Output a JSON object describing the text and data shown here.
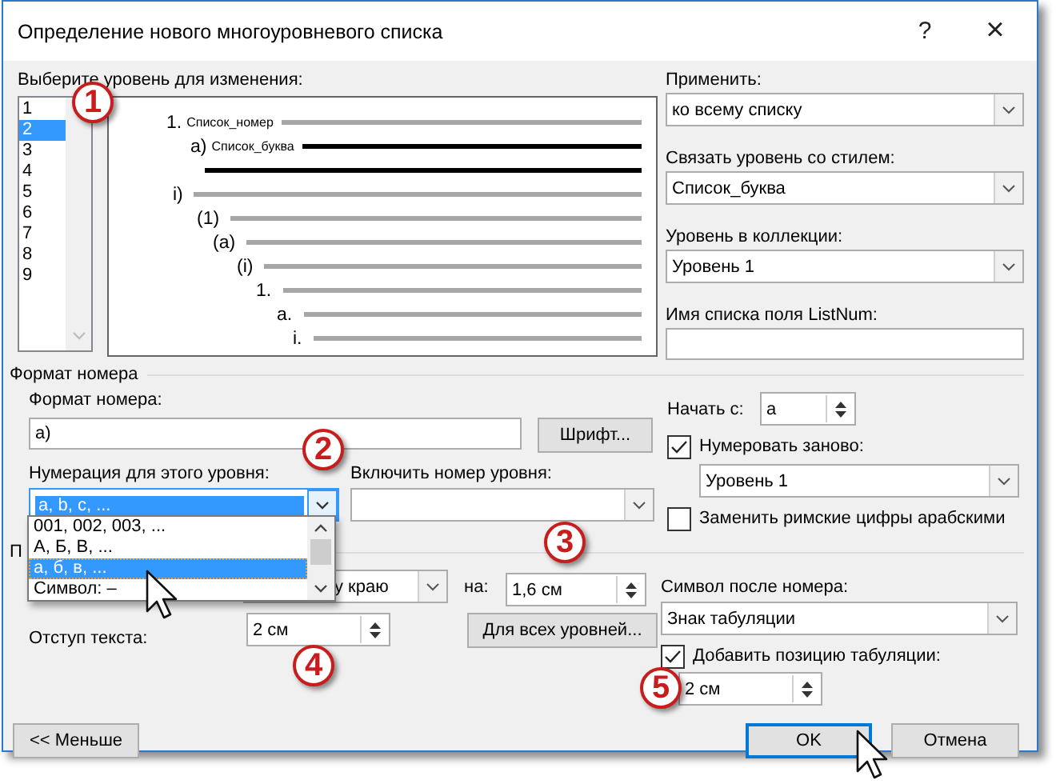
{
  "window": {
    "title": "Определение нового многоуровневого списка",
    "help": "?",
    "close": "×"
  },
  "level_picker": {
    "label": "Выберите уровень для изменения:",
    "levels": [
      {
        "label": "1",
        "selected": false
      },
      {
        "label": "2",
        "selected": true
      },
      {
        "label": "3",
        "selected": false
      },
      {
        "label": "4",
        "selected": false
      },
      {
        "label": "5",
        "selected": false
      },
      {
        "label": "6",
        "selected": false
      },
      {
        "label": "7",
        "selected": false
      },
      {
        "label": "8",
        "selected": false
      },
      {
        "label": "9",
        "selected": false
      }
    ]
  },
  "preview": {
    "items": [
      {
        "number": "1.",
        "style": "Список_номер",
        "selected": false
      },
      {
        "number": "a)",
        "style": "Список_буква",
        "selected": true
      },
      {
        "number": "i)",
        "selected": false
      },
      {
        "number": "(1)",
        "selected": false
      },
      {
        "number": "(a)",
        "selected": false
      },
      {
        "number": "(i)",
        "selected": false
      },
      {
        "number": "1.",
        "selected": false
      },
      {
        "number": "a.",
        "selected": false
      },
      {
        "number": "i.",
        "selected": false
      }
    ]
  },
  "apply": {
    "label": "Применить:",
    "value": "ко всему списку"
  },
  "link_style": {
    "label": "Связать уровень со стилем:",
    "value": "Список_буква"
  },
  "gallery_level": {
    "label": "Уровень в коллекции:",
    "value": "Уровень 1"
  },
  "listnum_name": {
    "label": "Имя списка поля ListNum:"
  },
  "number_format": {
    "title": "Формат номера",
    "format": {
      "label": "Формат номера:",
      "value": "a)"
    },
    "font_button": "Шрифт...",
    "numbering_style": {
      "label": "Нумерация для этого уровня:",
      "value": "a, b, c, ...",
      "expanded": true,
      "options": [
        {
          "label": "001, 002, 003, ...",
          "selected": false
        },
        {
          "label": "А, Б, В, ...",
          "selected": false
        },
        {
          "label": "а, б, в, ...",
          "selected": true
        },
        {
          "label": "Символ:  –",
          "selected": false
        }
      ]
    },
    "include_level": {
      "label": "Включить номер уровня:"
    },
    "start_at": {
      "label": "Начать с:",
      "value": "a"
    },
    "restart": {
      "label": "Нумеровать заново:",
      "checked": true,
      "value": "Уровень 1"
    },
    "legal": {
      "label": "Заменить римские цифры арабскими",
      "checked": false
    }
  },
  "position": {
    "title": "П",
    "alignment": {
      "value": "у краю"
    },
    "aligned_at": {
      "label": "на:",
      "value": "1,6 см"
    },
    "indent": {
      "label": "Отступ текста:",
      "value": "2 см"
    },
    "all_levels_button": "Для всех уровней...",
    "follow": {
      "label": "Символ после номера:",
      "value": "Знак табуляции"
    },
    "tab_stop": {
      "label": "Добавить позицию табуляции:",
      "checked": true,
      "value": "2 см"
    }
  },
  "buttons": [
    {
      "label": "<< Меньше",
      "kind": "more"
    },
    {
      "label": "OK",
      "kind": "default"
    },
    {
      "label": "Отмена",
      "kind": "cancel"
    }
  ],
  "callouts": [
    {
      "label": "1"
    },
    {
      "label": "2"
    },
    {
      "label": "3"
    },
    {
      "label": "4"
    },
    {
      "label": "5"
    }
  ]
}
